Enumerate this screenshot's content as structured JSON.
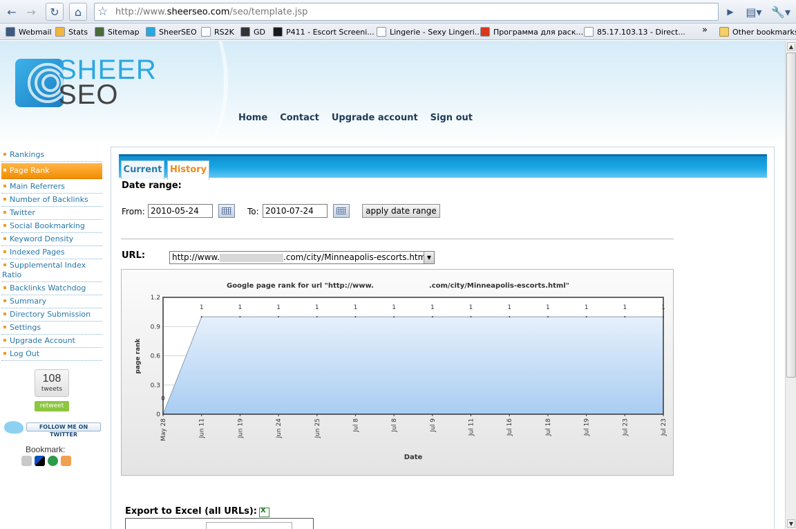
{
  "browser": {
    "url_prefix": "http://www.",
    "url_domain": "sheerseo.com",
    "url_path": "/seo/template.jsp"
  },
  "bookmarks": [
    {
      "label": "Webmail",
      "icon": "envelope-icon",
      "color": "#3d5a80"
    },
    {
      "label": "Stats",
      "icon": "smiley-icon",
      "color": "#f2b53c"
    },
    {
      "label": "Sitemap",
      "icon": "globe-icon",
      "color": "#486c3a"
    },
    {
      "label": "SheerSEO",
      "icon": "sheerseo-icon",
      "color": "#2aa7e0"
    },
    {
      "label": "RS2K",
      "icon": "page-icon",
      "color": "#ffffff"
    },
    {
      "label": "GD",
      "icon": "gd-icon",
      "color": "#333333"
    },
    {
      "label": "P411 - Escort Screeni...",
      "icon": "p411-icon",
      "color": "#1a1a1a"
    },
    {
      "label": "Lingerie - Sexy Lingeri...",
      "icon": "cw-icon",
      "color": "#ffffff"
    },
    {
      "label": "Программа для раск...",
      "icon": "vector-icon",
      "color": "#d9381e"
    },
    {
      "label": "85.17.103.13 - Direct...",
      "icon": "page-icon",
      "color": "#ffffff"
    }
  ],
  "bookmarks_overflow": "»",
  "other_bookmarks": "Other bookmarks",
  "logo": {
    "line1": "SHEER",
    "line2": "SEO"
  },
  "topnav": [
    "Home",
    "Contact",
    "Upgrade account",
    "Sign out"
  ],
  "sidebar": [
    {
      "label": "Rankings",
      "active": false
    },
    {
      "label": "Page Rank",
      "active": true
    },
    {
      "label": "Main Referrers",
      "active": false
    },
    {
      "label": "Number of Backlinks",
      "active": false
    },
    {
      "label": "Twitter",
      "active": false
    },
    {
      "label": "Social Bookmarking",
      "active": false
    },
    {
      "label": "Keyword Density",
      "active": false
    },
    {
      "label": "Indexed Pages",
      "active": false
    },
    {
      "label": "Supplemental Index Ratio",
      "active": false
    },
    {
      "label": "Backlinks Watchdog",
      "active": false
    },
    {
      "label": "Summary",
      "active": false
    },
    {
      "label": "Directory Submission",
      "active": false
    },
    {
      "label": "Settings",
      "active": false
    },
    {
      "label": "Upgrade Account",
      "active": false
    },
    {
      "label": "Log Out",
      "active": false
    }
  ],
  "tweets": {
    "count": "108",
    "label": "tweets",
    "retweet": "retweet"
  },
  "follow_label": "FOLLOW ME ON TWITTER",
  "bookmark_label": "Bookmark:",
  "tabs": {
    "current": "Current",
    "history": "History"
  },
  "date_range": {
    "title": "Date range:",
    "from_label": "From:",
    "from_value": "2010-05-24",
    "to_label": "To:",
    "to_value": "2010-07-24",
    "apply_label": "apply date range"
  },
  "url_select": {
    "label": "URL:",
    "value_prefix": "http://www.",
    "value_suffix": ".com/city/Minneapolis-escorts.html"
  },
  "export_label": "Export to Excel (all URLs):",
  "chart_data": {
    "type": "area",
    "title_prefix": "Google page rank for url \"http://www.",
    "title_suffix": ".com/city/Minneapolis-escorts.html\"",
    "xlabel": "Date",
    "ylabel": "page rank",
    "ylim": [
      0,
      1.2
    ],
    "yticks": [
      0,
      0.3,
      0.6,
      0.9,
      1.2
    ],
    "categories": [
      "May 28",
      "Jun 11",
      "Jun 19",
      "Jun 24",
      "Jun 25",
      "Jul 8",
      "Jul 8",
      "Jul 9",
      "Jul 11",
      "Jul 16",
      "Jul 18",
      "Jul 19",
      "Jul 23",
      "Jul 23"
    ],
    "series": [
      {
        "values": [
          0,
          1,
          1,
          1,
          1,
          1,
          1,
          1,
          1,
          1,
          1,
          1,
          1,
          1
        ]
      }
    ],
    "data_labels": [
      "0",
      "1",
      "1",
      "1",
      "1",
      "1",
      "1",
      "1",
      "1",
      "1",
      "1",
      "1",
      "1",
      "1"
    ],
    "grid": true,
    "fill_color": "#a9cdf2",
    "line_color": "#333333"
  }
}
